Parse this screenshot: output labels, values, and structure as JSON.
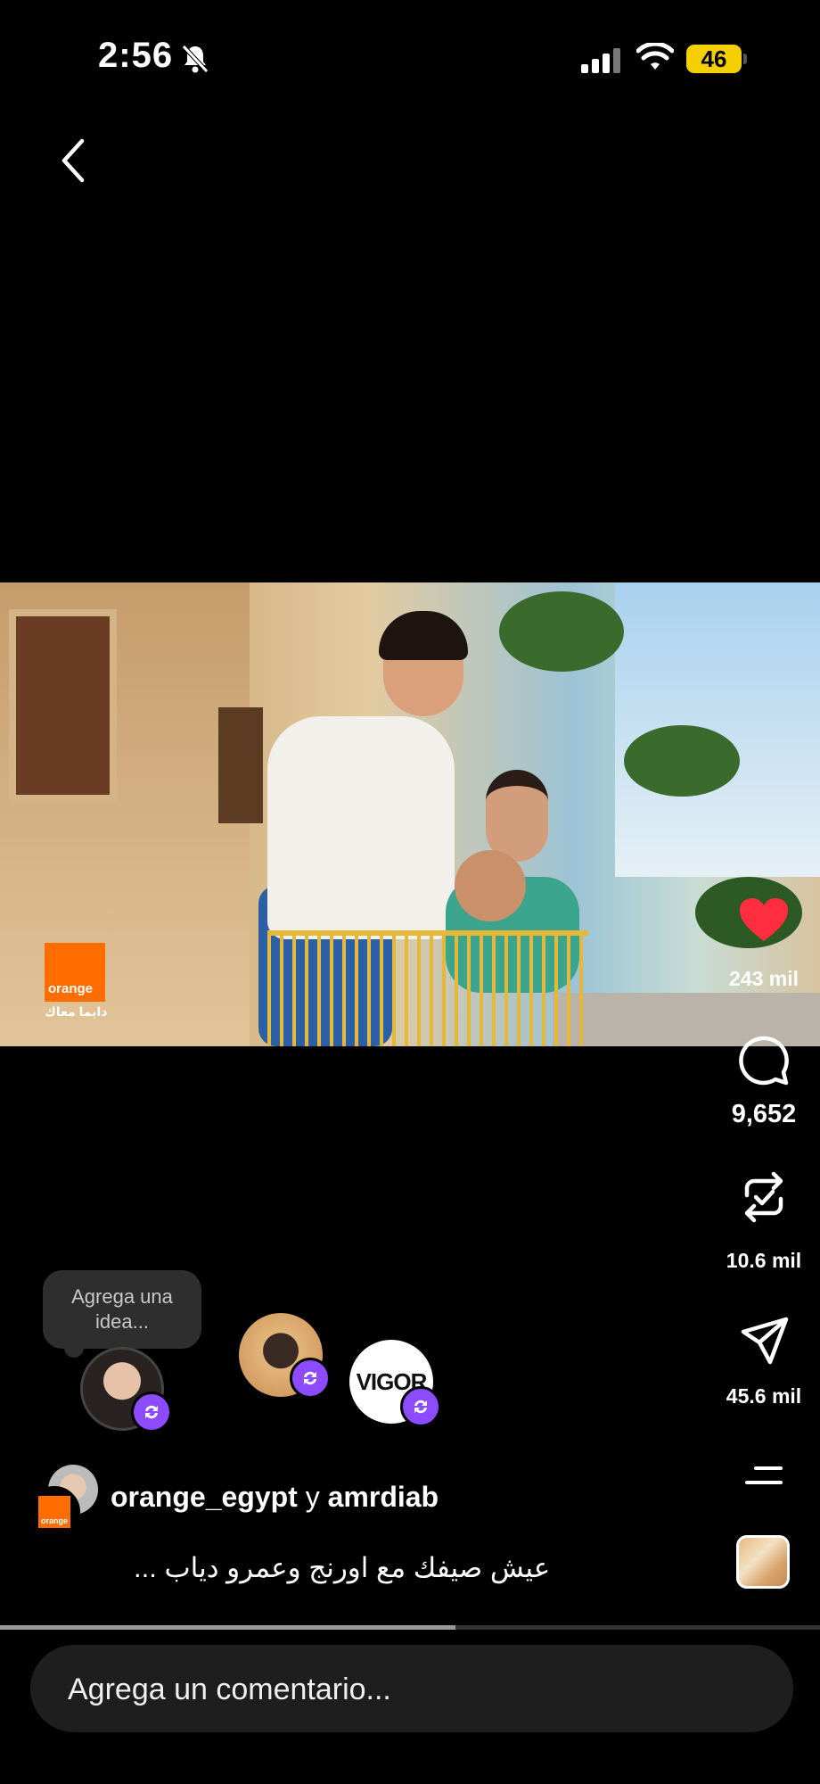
{
  "status_bar": {
    "time": "2:56",
    "battery": "46"
  },
  "video": {
    "brand_logo_text": "orange",
    "brand_tagline": "دايما معاك"
  },
  "actions": {
    "likes": "243 mil",
    "comments": "9,652",
    "reposts": "10.6 mil",
    "shares": "45.6 mil",
    "like_color": "#ff2d3d"
  },
  "notes": {
    "idea_prompt": "Agrega una idea...",
    "third_avatar_text": "VIGOR",
    "badge_color": "#8c4bff"
  },
  "post": {
    "author1": "orange_egypt",
    "connector": "y",
    "author2": "amrdiab",
    "caption": "عيش صيفك مع اورنج وعمرو دياب ..."
  },
  "progress": {
    "fraction": 0.555
  },
  "comment_input": {
    "placeholder": "Agrega un comentario..."
  }
}
